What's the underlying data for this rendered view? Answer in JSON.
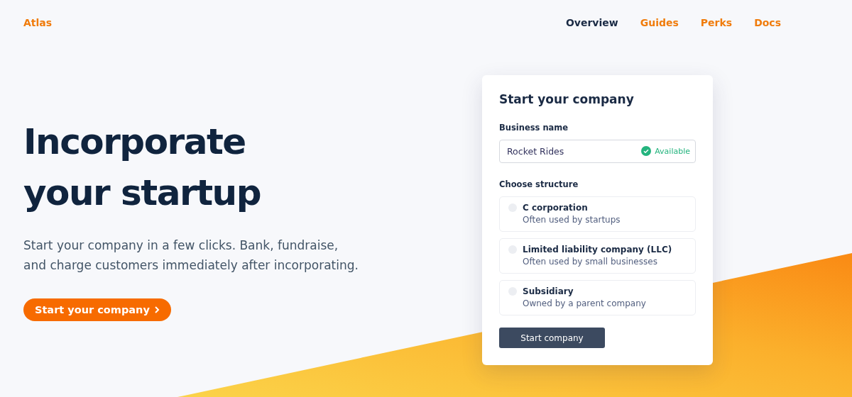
{
  "brand": "Atlas",
  "nav": [
    {
      "label": "Overview",
      "selected": true
    },
    {
      "label": "Guides",
      "selected": false
    },
    {
      "label": "Perks",
      "selected": false
    },
    {
      "label": "Docs",
      "selected": false
    }
  ],
  "hero": {
    "title_lines": [
      "Incorporate",
      "your startup"
    ],
    "lede_lines": [
      "Start your company in a few clicks. Bank, fundraise,",
      "and charge customers immediately after incorporating."
    ],
    "cta": "Start your company"
  },
  "form": {
    "title": "Start your company",
    "name_label": "Business name",
    "name_value": "Rocket Rides",
    "status": "Available",
    "structure_label": "Choose structure",
    "options": [
      {
        "title": "C corporation",
        "note": "Often used by startups",
        "selected": false
      },
      {
        "title": "Limited liability company (LLC)",
        "note": "Often used by small businesses",
        "selected": false
      },
      {
        "title": "Subsidiary",
        "note": "Owned by a parent company",
        "selected": false
      }
    ],
    "submit": "Start company"
  }
}
